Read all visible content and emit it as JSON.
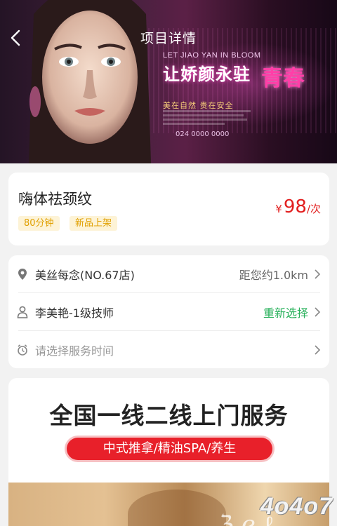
{
  "nav": {
    "title": "项目详情",
    "back_icon": "chevron-left-icon"
  },
  "banner": {
    "tagline_en": "LET JIAO YAN IN BLOOM",
    "headline": "让娇颜永驻",
    "headline_highlight": "青春",
    "slogan": "美在自然 贵在安全",
    "phone": "024 0000 0000"
  },
  "product": {
    "name": "嗨体祛颈纹",
    "tags": [
      "80分钟",
      "新品上架"
    ],
    "price": {
      "currency": "¥",
      "amount": "98",
      "unit": "/次",
      "color": "#e21f1f"
    }
  },
  "booking": {
    "store": {
      "icon": "location-pin-icon",
      "label": "美丝每念(NO.67店)",
      "right_text": "距您约1.0km"
    },
    "technician": {
      "icon": "person-icon",
      "label": "李美艳-1级技师",
      "right_text": "重新选择",
      "right_color": "#26b05a"
    },
    "time": {
      "icon": "alarm-clock-icon",
      "placeholder": "请选择服务时间"
    }
  },
  "promo": {
    "title": "全国一线二线上门服务",
    "pill": "中式推拿/精油SPA/养生",
    "pill_color": "#e8202a"
  },
  "watermark": "4o4o7"
}
